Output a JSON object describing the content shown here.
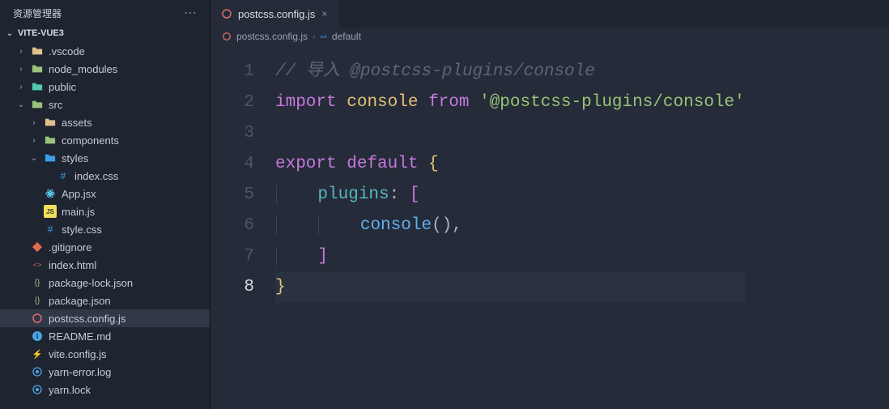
{
  "sidebar": {
    "title": "资源管理器",
    "project": "VITE-VUE3",
    "items": [
      {
        "label": ".vscode",
        "icon": "folder",
        "depth": 1,
        "chev": "right"
      },
      {
        "label": "node_modules",
        "icon": "folder-green",
        "depth": 1,
        "chev": "right"
      },
      {
        "label": "public",
        "icon": "folder-teal",
        "depth": 1,
        "chev": "right"
      },
      {
        "label": "src",
        "icon": "folder-green",
        "depth": 1,
        "chev": "down"
      },
      {
        "label": "assets",
        "icon": "folder",
        "depth": 2,
        "chev": "right"
      },
      {
        "label": "components",
        "icon": "folder-green",
        "depth": 2,
        "chev": "right"
      },
      {
        "label": "styles",
        "icon": "folder-blue",
        "depth": 2,
        "chev": "down"
      },
      {
        "label": "index.css",
        "icon": "css",
        "depth": 3
      },
      {
        "label": "App.jsx",
        "icon": "react",
        "depth": 2
      },
      {
        "label": "main.js",
        "icon": "js",
        "depth": 2
      },
      {
        "label": "style.css",
        "icon": "css",
        "depth": 2
      },
      {
        "label": ".gitignore",
        "icon": "git",
        "depth": 1
      },
      {
        "label": "index.html",
        "icon": "html",
        "depth": 1
      },
      {
        "label": "package-lock.json",
        "icon": "json",
        "depth": 1
      },
      {
        "label": "package.json",
        "icon": "json",
        "depth": 1
      },
      {
        "label": "postcss.config.js",
        "icon": "red",
        "depth": 1,
        "active": true
      },
      {
        "label": "README.md",
        "icon": "info",
        "depth": 1
      },
      {
        "label": "vite.config.js",
        "icon": "bolt",
        "depth": 1
      },
      {
        "label": "yarn-error.log",
        "icon": "yarn",
        "depth": 1
      },
      {
        "label": "yarn.lock",
        "icon": "yarn",
        "depth": 1
      }
    ]
  },
  "tab": {
    "filename": "postcss.config.js",
    "close": "×"
  },
  "breadcrumb": {
    "file": "postcss.config.js",
    "symbol": "default"
  },
  "code": {
    "lines": [
      {
        "n": "1",
        "t": "comment",
        "text": "// 导入 @postcss-plugins/console"
      },
      {
        "n": "2",
        "t": "import",
        "kw": "import",
        "name": "console",
        "from": "from",
        "str": "'@postcss-plugins/console'"
      },
      {
        "n": "3",
        "t": "blank",
        "text": ""
      },
      {
        "n": "4",
        "t": "export",
        "kw": "export default",
        "brace": "{"
      },
      {
        "n": "5",
        "t": "plugins",
        "prop": "plugins",
        "colon": ":",
        "bracket": "["
      },
      {
        "n": "6",
        "t": "call",
        "fn": "console",
        "paren": "()",
        "comma": ","
      },
      {
        "n": "7",
        "t": "closebracket",
        "bracket": "]"
      },
      {
        "n": "8",
        "t": "closebrace",
        "brace": "}",
        "current": true
      }
    ]
  }
}
